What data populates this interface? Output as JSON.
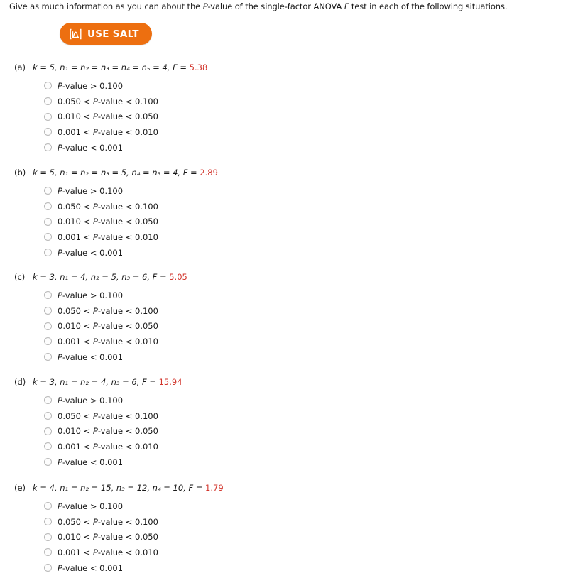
{
  "prompt": {
    "before_p": "Give as much information as you can about the ",
    "p_italic": "P",
    "middle": "-value of the single-factor ANOVA ",
    "f_italic": "F",
    "after_f": " test in each of the following situations."
  },
  "salt_button": {
    "label": "USE SALT",
    "icon": "distribution-curve-icon",
    "bg_color": "#ED6F10",
    "text_color": "#FFFFFF"
  },
  "colors": {
    "f_value": "#D2352C",
    "text": "#1A1A1A",
    "radio_border": "#B7B7B7",
    "rule": "#C8C8C8"
  },
  "options_template": [
    {
      "prefix": "",
      "p": "P",
      "suffix": "-value > 0.100"
    },
    {
      "prefix": "0.050 < ",
      "p": "P",
      "suffix": "-value < 0.100"
    },
    {
      "prefix": "0.010 < ",
      "p": "P",
      "suffix": "-value < 0.050"
    },
    {
      "prefix": "0.001 < ",
      "p": "P",
      "suffix": "-value < 0.010"
    },
    {
      "prefix": "",
      "p": "P",
      "suffix": "-value < 0.001"
    }
  ],
  "questions": [
    {
      "label": "(a)",
      "k": "k = 5,",
      "n_terms": "n₁ = n₂ = n₃ = n₄ = n₅ = 4,",
      "f_label": "F =",
      "f_value": "5.38",
      "options": [
        "P-value > 0.100",
        "0.050 < P-value < 0.100",
        "0.010 < P-value < 0.050",
        "0.001 < P-value < 0.010",
        "P-value < 0.001"
      ]
    },
    {
      "label": "(b)",
      "k": "k = 5,",
      "n_terms": "n₁ = n₂ = n₃ = 5, n₄ = n₅ = 4,",
      "f_label": "F =",
      "f_value": "2.89",
      "options": [
        "P-value > 0.100",
        "0.050 < P-value < 0.100",
        "0.010 < P-value < 0.050",
        "0.001 < P-value < 0.010",
        "P-value < 0.001"
      ]
    },
    {
      "label": "(c)",
      "k": "k = 3,",
      "n_terms": "n₁ = 4, n₂ = 5, n₃ = 6,",
      "f_label": "F =",
      "f_value": "5.05",
      "options": [
        "P-value > 0.100",
        "0.050 < P-value < 0.100",
        "0.010 < P-value < 0.050",
        "0.001 < P-value < 0.010",
        "P-value < 0.001"
      ]
    },
    {
      "label": "(d)",
      "k": "k = 3,",
      "n_terms": "n₁ = n₂ = 4, n₃ = 6,",
      "f_label": "F =",
      "f_value": "15.94",
      "options": [
        "P-value > 0.100",
        "0.050 < P-value < 0.100",
        "0.010 < P-value < 0.050",
        "0.001 < P-value < 0.010",
        "P-value < 0.001"
      ]
    },
    {
      "label": "(e)",
      "k": "k = 4,",
      "n_terms": "n₁ = n₂ = 15, n₃ = 12, n₄ = 10,",
      "f_label": "F =",
      "f_value": "1.79",
      "options": [
        "P-value > 0.100",
        "0.050 < P-value < 0.100",
        "0.010 < P-value < 0.050",
        "0.001 < P-value < 0.010",
        "P-value < 0.001"
      ]
    }
  ]
}
